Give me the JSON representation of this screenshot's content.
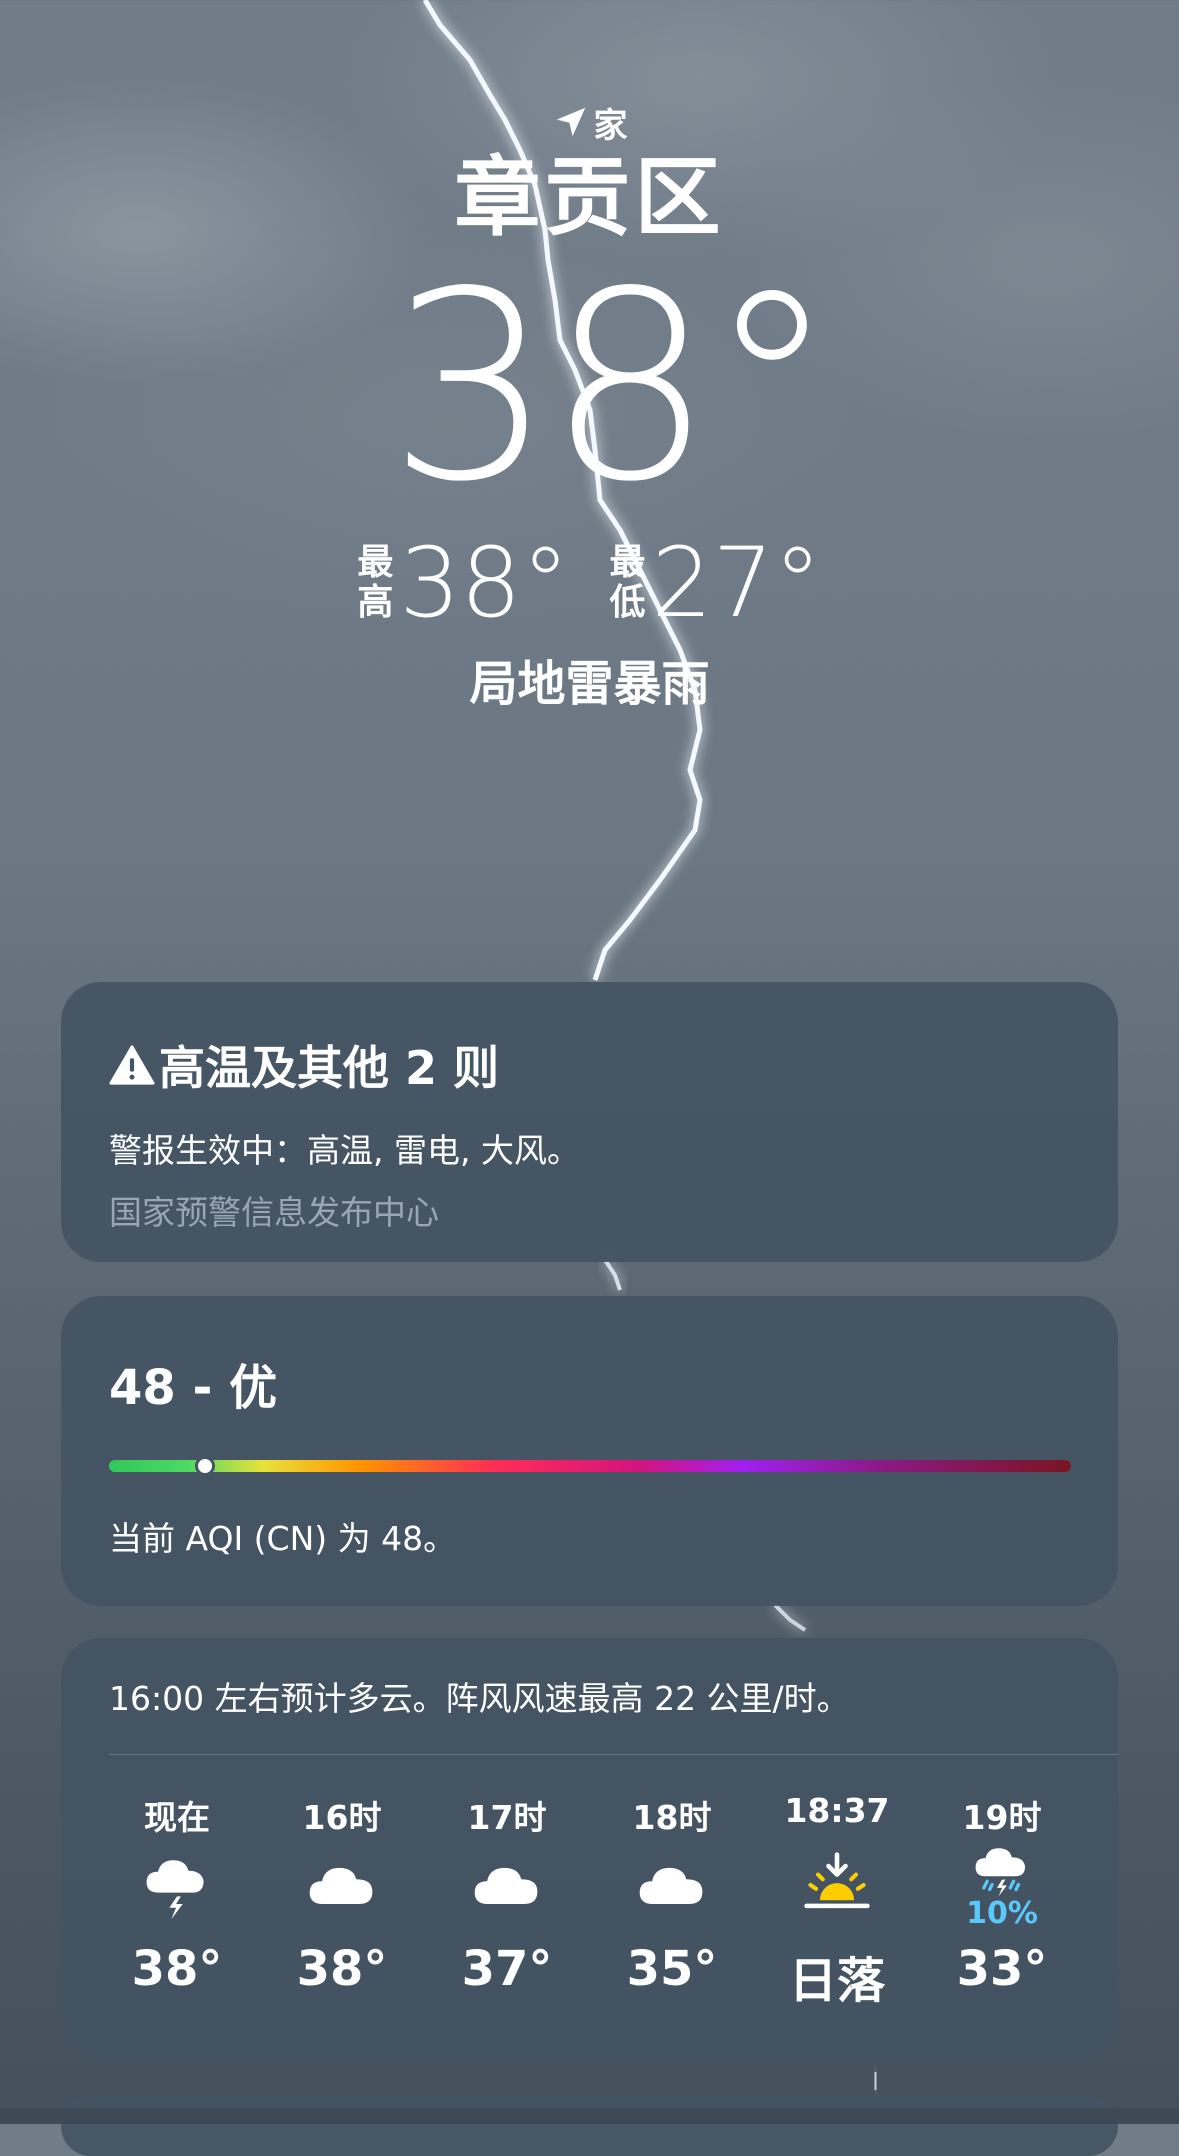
{
  "header": {
    "home_icon": "location-arrow-icon",
    "home_label": "家",
    "city": "章贡区",
    "temperature": "38°",
    "high_label_top": "最",
    "high_label_bottom": "高",
    "high_value": "38°",
    "low_label_top": "最",
    "low_label_bottom": "低",
    "low_value": "27°",
    "condition": "局地雷暴雨"
  },
  "alert": {
    "icon": "warning-triangle-icon",
    "title": "高温及其他 2 则",
    "description": "警报生效中：高温, 雷电, 大风。",
    "source": "国家预警信息发布中心"
  },
  "aqi": {
    "title": "48 - 优",
    "level_fraction": 0.1,
    "description": "当前 AQI (CN) 为 48。"
  },
  "hourly": {
    "summary": "16:00 左右预计多云。阵风风速最高 22 公里/时。",
    "hours": [
      {
        "label": "现在",
        "icon": "thunderstorm-cloud-icon",
        "temp": "38°",
        "pop": ""
      },
      {
        "label": "16时",
        "icon": "cloud-icon",
        "temp": "38°",
        "pop": ""
      },
      {
        "label": "17时",
        "icon": "cloud-icon",
        "temp": "37°",
        "pop": ""
      },
      {
        "label": "18时",
        "icon": "cloud-icon",
        "temp": "35°",
        "pop": ""
      },
      {
        "label": "18:37",
        "icon": "sunset-icon",
        "temp": "日落",
        "pop": ""
      },
      {
        "label": "19时",
        "icon": "thunderstorm-rain-icon",
        "temp": "33°",
        "pop": "10%"
      }
    ]
  },
  "colors": {
    "card_bg": "#445563",
    "precip_blue": "#5ac8fa",
    "sun_yellow": "#ffcc00"
  }
}
